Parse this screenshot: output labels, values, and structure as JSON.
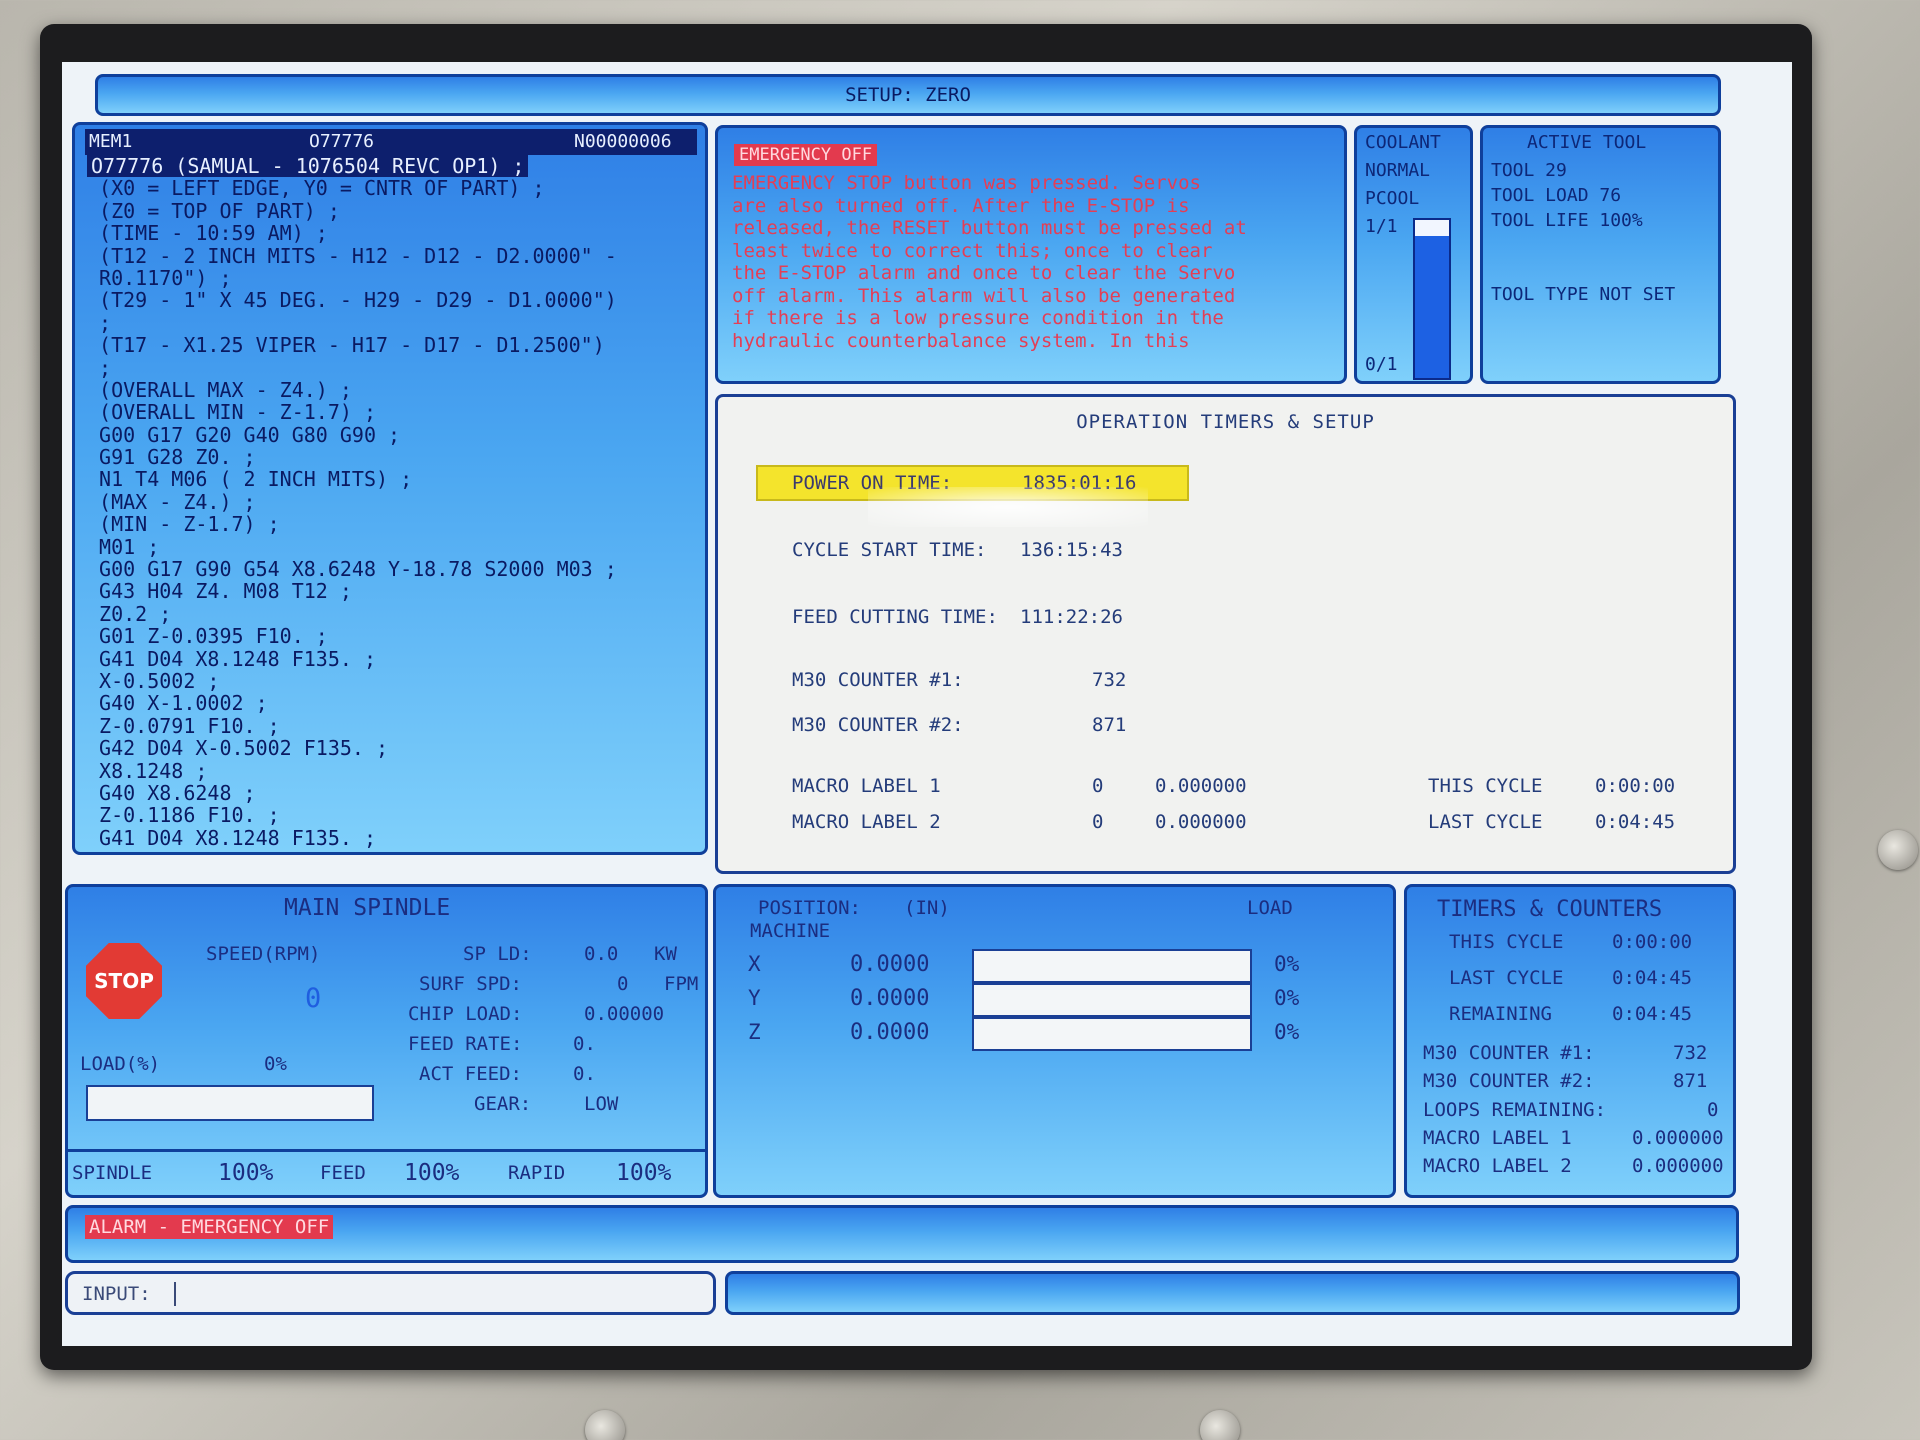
{
  "setup_bar": {
    "title": "SETUP: ZERO"
  },
  "program": {
    "mode": "MEM1",
    "program_number": "O77776",
    "sequence": "N00000006",
    "lines": [
      "O77776 (SAMUAL - 1076504 REVC OP1) ;",
      " (X0 = LEFT EDGE, Y0 = CNTR OF PART) ;",
      " (Z0 = TOP OF PART) ;",
      " (TIME - 10:59 AM) ;",
      " (T12 - 2 INCH MITS - H12 - D12 - D2.0000\" -",
      " R0.1170\") ;",
      " (T29 - 1\" X 45 DEG. - H29 - D29 - D1.0000\")",
      " ;",
      " (T17 - X1.25 VIPER - H17 - D17 - D1.2500\")",
      " ;",
      " (OVERALL MAX - Z4.) ;",
      " (OVERALL MIN - Z-1.7) ;",
      " G00 G17 G20 G40 G80 G90 ;",
      " G91 G28 Z0. ;",
      " N1 T4 M06 ( 2 INCH MITS) ;",
      " (MAX - Z4.) ;",
      " (MIN - Z-1.7) ;",
      " M01 ;",
      " G00 G17 G90 G54 X8.6248 Y-18.78 S2000 M03 ;",
      " G43 H04 Z4. M08 T12 ;",
      " Z0.2 ;",
      " G01 Z-0.0395 F10. ;",
      " G41 D04 X8.1248 F135. ;",
      " X-0.5002 ;",
      " G40 X-1.0002 ;",
      " Z-0.0791 F10. ;",
      " G42 D04 X-0.5002 F135. ;",
      " X8.1248 ;",
      " G40 X8.6248 ;",
      " Z-0.1186 F10. ;",
      " G41 D04 X8.1248 F135. ;"
    ]
  },
  "alarm_message": {
    "title": "EMERGENCY OFF",
    "lines": [
      "EMERGENCY STOP button was pressed.  Servos",
      "are also turned off.  After the E-STOP is",
      "released, the RESET button must be pressed at",
      "least twice to correct this; once to clear",
      "the E-STOP alarm and once to clear the Servo",
      "off alarm. This alarm will also be generated",
      "if there is a low pressure condition in the",
      "hydraulic counterbalance system.  In this"
    ]
  },
  "coolant": {
    "title": "COOLANT",
    "status": "NORMAL",
    "pcool": "PCOOL",
    "top_ratio": "1/1",
    "bottom_ratio": "0/1",
    "level_fraction": 0.9
  },
  "active_tool": {
    "title": "ACTIVE TOOL",
    "tool": "TOOL 29",
    "tool_load": "TOOL LOAD 76",
    "tool_life": "TOOL LIFE 100%",
    "tool_type": "TOOL TYPE NOT SET"
  },
  "operation_timers": {
    "title": "OPERATION TIMERS & SETUP",
    "power_on_label": "POWER ON TIME:",
    "power_on_value": "1835:01:16",
    "cycle_start_label": "CYCLE START TIME:",
    "cycle_start_value": "136:15:43",
    "feed_cutting_label": "FEED CUTTING TIME:",
    "feed_cutting_value": "111:22:26",
    "m30_1_label": "M30 COUNTER #1:",
    "m30_1_value": "732",
    "m30_2_label": "M30 COUNTER #2:",
    "m30_2_value": "871",
    "macro1_label": "MACRO LABEL 1",
    "macro1_int": "0",
    "macro1_val": "0.000000",
    "macro2_label": "MACRO LABEL 2",
    "macro2_int": "0",
    "macro2_val": "0.000000",
    "this_cycle_label": "THIS CYCLE",
    "this_cycle_value": "0:00:00",
    "last_cycle_label": "LAST CYCLE",
    "last_cycle_value": "0:04:45"
  },
  "spindle": {
    "title": "MAIN SPINDLE",
    "stop_label": "STOP",
    "speed_label": "SPEED(RPM)",
    "speed_value": "0",
    "load_label": "LOAD(%)",
    "load_value": "0%",
    "load_fraction": 0,
    "sp_ld_label": "SP LD:",
    "sp_ld_value": "0.0",
    "sp_ld_unit": "KW",
    "surf_spd_label": "SURF SPD:",
    "surf_spd_value": "0",
    "surf_spd_unit": "FPM",
    "chip_load_label": "CHIP LOAD:",
    "chip_load_value": "0.00000",
    "feed_rate_label": "FEED RATE:",
    "feed_rate_value": "0.",
    "act_feed_label": "ACT FEED:",
    "act_feed_value": "0.",
    "gear_label": "GEAR:",
    "gear_value": "LOW",
    "overrides": {
      "spindle_label": "SPINDLE",
      "spindle_value": "100%",
      "feed_label": "FEED",
      "feed_value": "100%",
      "rapid_label": "RAPID",
      "rapid_value": "100%"
    }
  },
  "position": {
    "title": "POSITION:",
    "units": "(IN)",
    "mode": "MACHINE",
    "load_title": "LOAD",
    "axes": [
      {
        "name": "X",
        "value": "0.0000",
        "load": "0%",
        "load_fraction": 0
      },
      {
        "name": "Y",
        "value": "0.0000",
        "load": "0%",
        "load_fraction": 0
      },
      {
        "name": "Z",
        "value": "0.0000",
        "load": "0%",
        "load_fraction": 0
      }
    ]
  },
  "timers_counters": {
    "title": "TIMERS & COUNTERS",
    "this_cycle_label": "THIS CYCLE",
    "this_cycle_value": "0:00:00",
    "last_cycle_label": "LAST CYCLE",
    "last_cycle_value": "0:04:45",
    "remaining_label": "REMAINING",
    "remaining_value": "0:04:45",
    "m30_1_label": "M30 COUNTER #1:",
    "m30_1_value": "732",
    "m30_2_label": "M30 COUNTER #2:",
    "m30_2_value": "871",
    "loops_label": "LOOPS REMAINING:",
    "loops_value": "0",
    "macro1_label": "MACRO LABEL 1",
    "macro1_value": "0.000000",
    "macro2_label": "MACRO LABEL 2",
    "macro2_value": "0.000000"
  },
  "alarm_bar": {
    "text": "ALARM - EMERGENCY OFF"
  },
  "input": {
    "label": "INPUT:"
  }
}
